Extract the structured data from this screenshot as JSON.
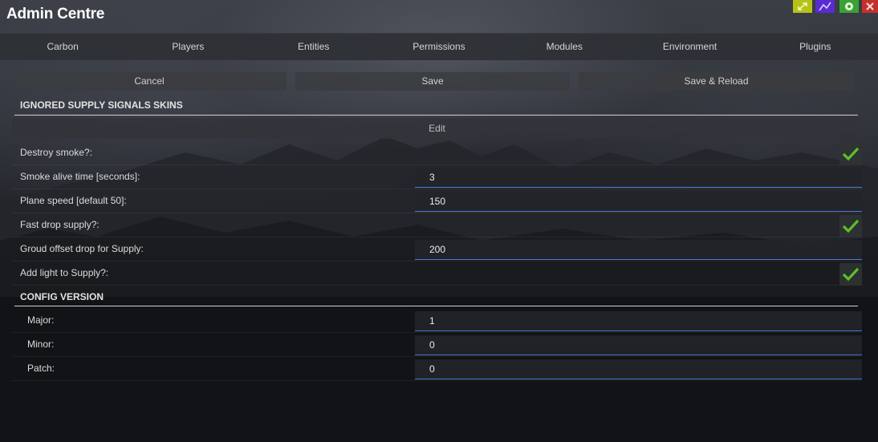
{
  "window": {
    "title": "Admin Centre",
    "buttons": [
      {
        "name": "expand-icon",
        "color": "#b6c21a"
      },
      {
        "name": "graph-icon",
        "color": "#5a2bd0"
      },
      {
        "name": "gear-icon",
        "color": "#3aa235"
      },
      {
        "name": "close-icon",
        "color": "#c4312b"
      }
    ]
  },
  "nav": {
    "tabs": [
      "Carbon",
      "Players",
      "Entities",
      "Permissions",
      "Modules",
      "Environment",
      "Plugins"
    ]
  },
  "actions": {
    "cancel": "Cancel",
    "save": "Save",
    "save_reload": "Save & Reload"
  },
  "section1": {
    "title": "IGNORED SUPPLY SIGNALS SKINS",
    "edit_label": "Edit",
    "rows": [
      {
        "label": "Destroy smoke?:",
        "type": "toggle",
        "checked": true
      },
      {
        "label": "Smoke alive time [seconds]:",
        "type": "text",
        "value": "3"
      },
      {
        "label": "Plane speed [default 50]:",
        "type": "text",
        "value": "150"
      },
      {
        "label": "Fast drop supply?:",
        "type": "toggle",
        "checked": true
      },
      {
        "label": "Groud offset drop for Supply:",
        "type": "text",
        "value": "200"
      },
      {
        "label": "Add light to Supply?:",
        "type": "toggle",
        "checked": true
      }
    ]
  },
  "section2": {
    "title": "CONFIG VERSION",
    "rows": [
      {
        "label": "Major:",
        "value": "1"
      },
      {
        "label": "Minor:",
        "value": "0"
      },
      {
        "label": "Patch:",
        "value": "0"
      }
    ]
  },
  "colors": {
    "accent_underline": "#4b7bd8",
    "check_green": "#5bbf2f"
  }
}
